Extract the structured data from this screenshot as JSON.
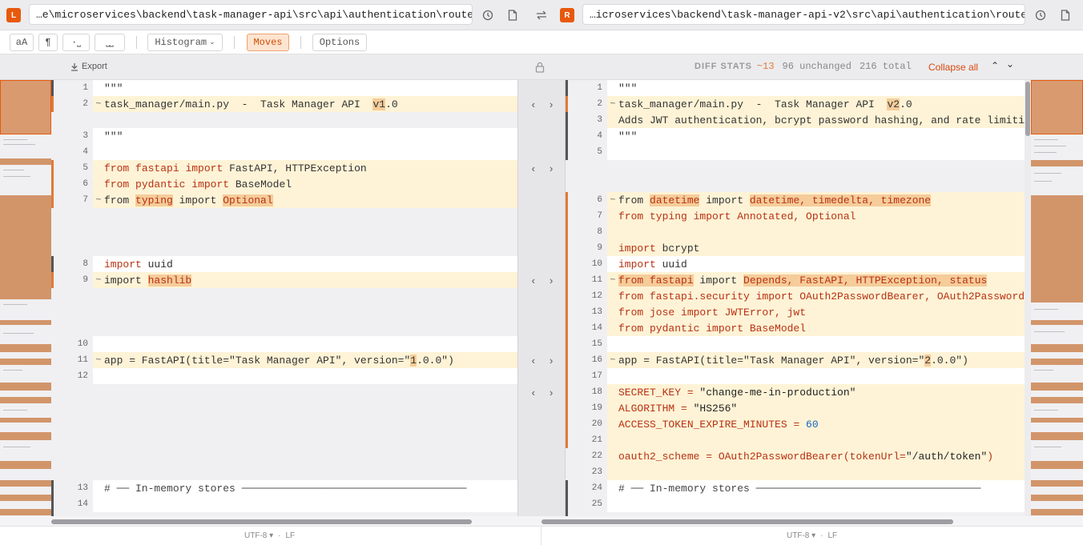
{
  "left_pane": {
    "badge": "L",
    "path": "…e\\microservices\\backend\\task-manager-api\\src\\api\\authentication\\routes.py"
  },
  "right_pane": {
    "badge": "R",
    "path": "…icroservices\\backend\\task-manager-api-v2\\src\\api\\authentication\\routes.py"
  },
  "toolbar": {
    "case_label": "aA",
    "pilcrow_label": "¶",
    "dot_space_label": "·⎵",
    "spaces_label": "⎵⎵",
    "algorithm_label": "Histogram",
    "moves_label": "Moves",
    "options_label": "Options"
  },
  "header": {
    "export_label": "Export",
    "diff_stats_label": "DIFF STATS",
    "changed": "~13",
    "unchanged": "96 unchanged",
    "total": "216 total",
    "collapse_all": "Collapse all"
  },
  "left_code": [
    {
      "n": "1",
      "t": "\"\"\""
    },
    {
      "n": "2",
      "t": "task_manager/main.py  -  Task Manager API  v1.0"
    },
    {
      "n": "3",
      "t": "\"\"\""
    },
    {
      "n": "4",
      "t": ""
    },
    {
      "n": "5",
      "t": "from fastapi import FastAPI, HTTPException"
    },
    {
      "n": "6",
      "t": "from pydantic import BaseModel"
    },
    {
      "n": "7",
      "t": "from typing import Optional"
    },
    {
      "n": "8",
      "t": "import uuid"
    },
    {
      "n": "9",
      "t": "import hashlib"
    },
    {
      "n": "10",
      "t": ""
    },
    {
      "n": "11",
      "t": "app = FastAPI(title=\"Task Manager API\", version=\"1.0.0\")"
    },
    {
      "n": "12",
      "t": ""
    },
    {
      "n": "13",
      "t": "# ── In-memory stores ────────────────────────────────────"
    },
    {
      "n": "14",
      "t": ""
    }
  ],
  "right_code": [
    {
      "n": "1",
      "t": "\"\"\""
    },
    {
      "n": "2",
      "t": "task_manager/main.py  -  Task Manager API  v2.0"
    },
    {
      "n": "3",
      "t": "Adds JWT authentication, bcrypt password hashing, and rate limiti"
    },
    {
      "n": "4",
      "t": "\"\"\""
    },
    {
      "n": "5",
      "t": ""
    },
    {
      "n": "6",
      "t": "from datetime import datetime, timedelta, timezone"
    },
    {
      "n": "7",
      "t": "from typing import Annotated, Optional"
    },
    {
      "n": "8",
      "t": ""
    },
    {
      "n": "9",
      "t": "import bcrypt"
    },
    {
      "n": "10",
      "t": "import uuid"
    },
    {
      "n": "11",
      "t": "from fastapi import Depends, FastAPI, HTTPException, status"
    },
    {
      "n": "12",
      "t": "from fastapi.security import OAuth2PasswordBearer, OAuth2Password"
    },
    {
      "n": "13",
      "t": "from jose import JWTError, jwt"
    },
    {
      "n": "14",
      "t": "from pydantic import BaseModel"
    },
    {
      "n": "15",
      "t": ""
    },
    {
      "n": "16",
      "t": "app = FastAPI(title=\"Task Manager API\", version=\"2.0.0\")"
    },
    {
      "n": "17",
      "t": ""
    },
    {
      "n": "18",
      "t": "SECRET_KEY = \"change-me-in-production\""
    },
    {
      "n": "19",
      "t": "ALGORITHM = \"HS256\""
    },
    {
      "n": "20",
      "t": "ACCESS_TOKEN_EXPIRE_MINUTES = 60"
    },
    {
      "n": "21",
      "t": ""
    },
    {
      "n": "22",
      "t": "oauth2_scheme = OAuth2PasswordBearer(tokenUrl=\"/auth/token\")"
    },
    {
      "n": "23",
      "t": ""
    },
    {
      "n": "24",
      "t": "# ── In-memory stores ────────────────────────────────────"
    },
    {
      "n": "25",
      "t": ""
    }
  ],
  "status": {
    "left_encoding": "UTF-8",
    "left_eol": "LF",
    "right_encoding": "UTF-8",
    "right_eol": "LF"
  },
  "colors": {
    "accent": "#e8590c",
    "changed_bg": "#fef3d6",
    "token_highlight": "#f5cc9a"
  }
}
